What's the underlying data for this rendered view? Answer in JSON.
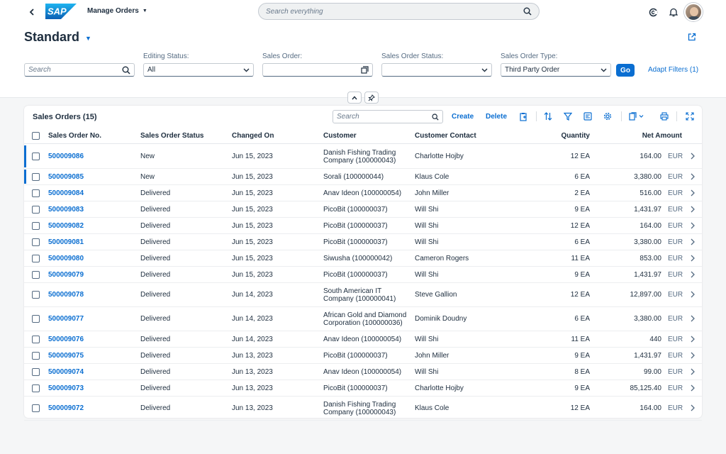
{
  "shell": {
    "app_title": "Manage Orders",
    "search_placeholder": "Search everything",
    "icons": [
      "back-arrow-icon",
      "copilot-icon",
      "bell-icon",
      "search-icon"
    ],
    "brand_color": "#0a6ed1"
  },
  "header": {
    "variant": "Standard",
    "filters": {
      "search_placeholder": "Search",
      "editing_status_label": "Editing Status:",
      "editing_status_value": "All",
      "sales_order_label": "Sales Order:",
      "sales_order_status_label": "Sales Order Status:",
      "sales_order_type_label": "Sales Order Type:",
      "sales_order_type_value": "Third Party Order",
      "go_label": "Go",
      "adapt_label": "Adapt Filters (1)"
    }
  },
  "table": {
    "title": "Sales Orders (15)",
    "search_placeholder": "Search",
    "create_label": "Create",
    "delete_label": "Delete",
    "columns": [
      "Sales Order No.",
      "Sales Order Status",
      "Changed On",
      "Customer",
      "Customer Contact",
      "Quantity",
      "Net Amount"
    ],
    "rows": [
      {
        "so": "500009086",
        "status": "New",
        "changed": "Jun 15, 2023",
        "customer": [
          "Danish Fishing Trading",
          "Company (100000043)"
        ],
        "contact": "Charlotte Hojby",
        "qty": "12 EA",
        "amount": "164.00",
        "currency": "EUR",
        "highlight": true
      },
      {
        "so": "500009085",
        "status": "New",
        "changed": "Jun 15, 2023",
        "customer": [
          "Sorali (100000044)"
        ],
        "contact": "Klaus Cole",
        "qty": "6 EA",
        "amount": "3,380.00",
        "currency": "EUR",
        "highlight": true
      },
      {
        "so": "500009084",
        "status": "Delivered",
        "changed": "Jun 15, 2023",
        "customer": [
          "Anav Ideon (100000054)"
        ],
        "contact": "John Miller",
        "qty": "2 EA",
        "amount": "516.00",
        "currency": "EUR"
      },
      {
        "so": "500009083",
        "status": "Delivered",
        "changed": "Jun 15, 2023",
        "customer": [
          "PicoBit (100000037)"
        ],
        "contact": "Will Shi",
        "qty": "9 EA",
        "amount": "1,431.97",
        "currency": "EUR"
      },
      {
        "so": "500009082",
        "status": "Delivered",
        "changed": "Jun 15, 2023",
        "customer": [
          "PicoBit (100000037)"
        ],
        "contact": "Will Shi",
        "qty": "12 EA",
        "amount": "164.00",
        "currency": "EUR"
      },
      {
        "so": "500009081",
        "status": "Delivered",
        "changed": "Jun 15, 2023",
        "customer": [
          "PicoBit (100000037)"
        ],
        "contact": "Will Shi",
        "qty": "6 EA",
        "amount": "3,380.00",
        "currency": "EUR"
      },
      {
        "so": "500009080",
        "status": "Delivered",
        "changed": "Jun 15, 2023",
        "customer": [
          "Siwusha (100000042)"
        ],
        "contact": "Cameron Rogers",
        "qty": "11 EA",
        "amount": "853.00",
        "currency": "EUR"
      },
      {
        "so": "500009079",
        "status": "Delivered",
        "changed": "Jun 15, 2023",
        "customer": [
          "PicoBit (100000037)"
        ],
        "contact": "Will Shi",
        "qty": "9 EA",
        "amount": "1,431.97",
        "currency": "EUR"
      },
      {
        "so": "500009078",
        "status": "Delivered",
        "changed": "Jun 14, 2023",
        "customer": [
          "South American IT",
          "Company (100000041)"
        ],
        "contact": "Steve Gallion",
        "qty": "12 EA",
        "amount": "12,897.00",
        "currency": "EUR"
      },
      {
        "so": "500009077",
        "status": "Delivered",
        "changed": "Jun 14, 2023",
        "customer": [
          "African Gold and Diamond",
          "Corporation (100000036)"
        ],
        "contact": "Dominik Doudny",
        "qty": "6 EA",
        "amount": "3,380.00",
        "currency": "EUR"
      },
      {
        "so": "500009076",
        "status": "Delivered",
        "changed": "Jun 14, 2023",
        "customer": [
          "Anav Ideon (100000054)"
        ],
        "contact": "Will Shi",
        "qty": "11 EA",
        "amount": "440",
        "currency": "EUR"
      },
      {
        "so": "500009075",
        "status": "Delivered",
        "changed": "Jun 13, 2023",
        "customer": [
          "PicoBit (100000037)"
        ],
        "contact": "John Miller",
        "qty": "9 EA",
        "amount": "1,431.97",
        "currency": "EUR"
      },
      {
        "so": "500009074",
        "status": "Delivered",
        "changed": "Jun 13, 2023",
        "customer": [
          "Anav Ideon (100000054)"
        ],
        "contact": "Will Shi",
        "qty": "8 EA",
        "amount": "99.00",
        "currency": "EUR"
      },
      {
        "so": "500009073",
        "status": "Delivered",
        "changed": "Jun 13, 2023",
        "customer": [
          "PicoBit (100000037)"
        ],
        "contact": "Charlotte Hojby",
        "qty": "9 EA",
        "amount": "85,125.40",
        "currency": "EUR"
      },
      {
        "so": "500009072",
        "status": "Delivered",
        "changed": "Jun 13, 2023",
        "customer": [
          "Danish Fishing Trading",
          "Company (100000043)"
        ],
        "contact": "Klaus Cole",
        "qty": "12 EA",
        "amount": "164.00",
        "currency": "EUR"
      }
    ]
  }
}
